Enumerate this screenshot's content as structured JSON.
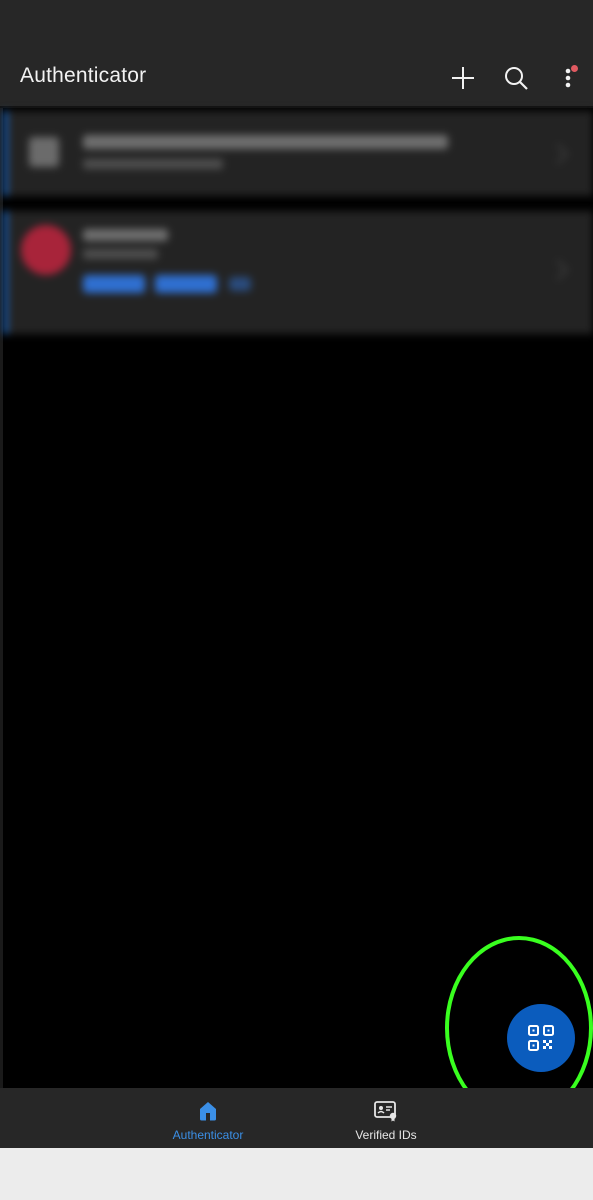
{
  "app": {
    "title": "Authenticator"
  },
  "toolbar": {
    "add_icon": "plus-icon",
    "search_icon": "search-icon",
    "more_icon": "more-vertical-icon",
    "notification_dot_color": "#e05a61"
  },
  "fab": {
    "icon": "qr-code-icon",
    "color": "#0b5cbd"
  },
  "bottom_nav": {
    "items": [
      {
        "label": "Authenticator",
        "icon": "home-icon",
        "selected": true
      },
      {
        "label": "Verified IDs",
        "icon": "id-card-icon",
        "selected": false
      }
    ]
  },
  "colors": {
    "accent": "#3b8fe6",
    "highlight": "#39ff1f"
  }
}
